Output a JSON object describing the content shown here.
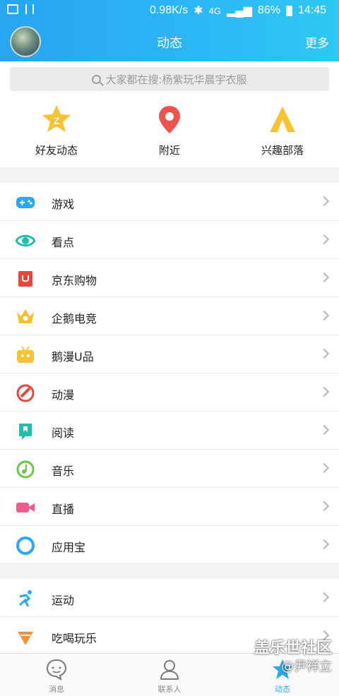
{
  "status_bar": {
    "speed": "0.98K/s",
    "network": "4G",
    "battery": "86%",
    "time": "14:45"
  },
  "header": {
    "title": "动态",
    "more": "更多"
  },
  "search": {
    "placeholder": "大家都在搜:杨紫玩华晨宇衣服"
  },
  "quick_items": [
    {
      "label": "好友动态",
      "icon": "qzone-star-icon"
    },
    {
      "label": "附近",
      "icon": "location-pin-icon"
    },
    {
      "label": "兴趣部落",
      "icon": "tribe-tent-icon"
    }
  ],
  "list_group_1": [
    {
      "label": "游戏",
      "icon": "gamepad-icon",
      "color": "#2aa9f0"
    },
    {
      "label": "看点",
      "icon": "eye-icon",
      "color": "#1fc0a8"
    },
    {
      "label": "京东购物",
      "icon": "jd-shopping-icon",
      "color": "#e8453c"
    },
    {
      "label": "企鹅电竞",
      "icon": "crown-icon",
      "color": "#f5c02a"
    },
    {
      "label": "鹅漫U品",
      "icon": "tv-robot-icon",
      "color": "#f7c234"
    },
    {
      "label": "动漫",
      "icon": "comic-icon",
      "color": "#e8453c"
    },
    {
      "label": "阅读",
      "icon": "bookmark-icon",
      "color": "#1fc0a8"
    },
    {
      "label": "音乐",
      "icon": "music-note-icon",
      "color": "#6cc644"
    },
    {
      "label": "直播",
      "icon": "video-camera-icon",
      "color": "#f05d8c"
    },
    {
      "label": "应用宝",
      "icon": "app-store-icon",
      "color": "#2aa9f0"
    }
  ],
  "list_group_2": [
    {
      "label": "运动",
      "icon": "running-icon",
      "color": "#2aa9f0"
    },
    {
      "label": "吃喝玩乐",
      "icon": "food-icon",
      "color": "#f5913c"
    }
  ],
  "bottom_nav": [
    {
      "label": "消息",
      "icon": "message-icon",
      "active": false
    },
    {
      "label": "联系人",
      "icon": "contacts-icon",
      "active": false
    },
    {
      "label": "动态",
      "icon": "star-icon",
      "active": true
    }
  ],
  "watermark": {
    "line1": "盖乐世社区",
    "line2": "@尹祥立"
  }
}
